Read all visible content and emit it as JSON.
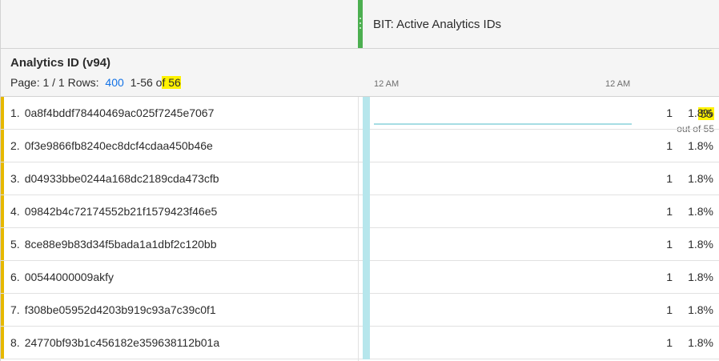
{
  "metric": {
    "title": "BIT: Active Analytics IDs"
  },
  "dimension": {
    "title": "Analytics ID (v94)",
    "pager": {
      "page_label": "Page: 1 / 1",
      "rows_label": "Rows:",
      "rows_count": "400",
      "range_prefix": "1-56 o",
      "range_highlight": "f 56"
    }
  },
  "trend": {
    "axis_start": "12 AM",
    "axis_end": "12 AM"
  },
  "totals": {
    "value": "55",
    "sub": "out of 55"
  },
  "rows": [
    {
      "idx": "1.",
      "id": "0a8f4bddf78440469ac025f7245e7067",
      "count": "1",
      "pct": "1.8%"
    },
    {
      "idx": "2.",
      "id": "0f3e9866fb8240ec8dcf4cdaa450b46e",
      "count": "1",
      "pct": "1.8%"
    },
    {
      "idx": "3.",
      "id": "d04933bbe0244a168dc2189cda473cfb",
      "count": "1",
      "pct": "1.8%"
    },
    {
      "idx": "4.",
      "id": "09842b4c72174552b21f1579423f46e5",
      "count": "1",
      "pct": "1.8%"
    },
    {
      "idx": "5.",
      "id": "8ce88e9b83d34f5bada1a1dbf2c120bb",
      "count": "1",
      "pct": "1.8%"
    },
    {
      "idx": "6.",
      "id": "00544000009akfy",
      "count": "1",
      "pct": "1.8%"
    },
    {
      "idx": "7.",
      "id": "f308be05952d4203b919c93a7c39c0f1",
      "count": "1",
      "pct": "1.8%"
    },
    {
      "idx": "8.",
      "id": "24770bf93b1c456182e359638112b01a",
      "count": "1",
      "pct": "1.8%"
    }
  ],
  "colors": {
    "accent": "#e6b800",
    "handle": "#4caf50",
    "trend": "#a6dde4",
    "highlight": "#fff200",
    "link": "#1473e6"
  }
}
